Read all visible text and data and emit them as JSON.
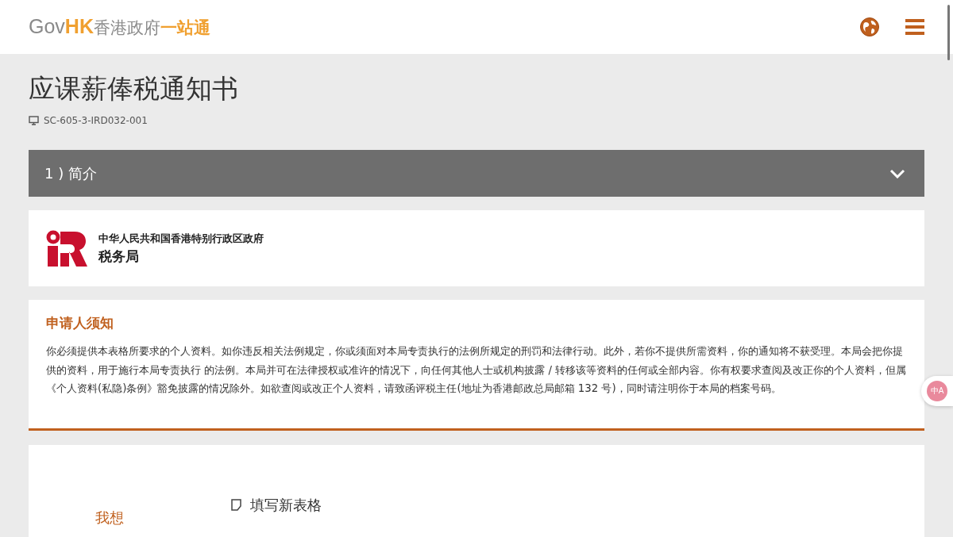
{
  "header": {
    "logo": {
      "gov": "Gov",
      "hk": "HK",
      "name": "香港政府",
      "tagline": "一站通"
    }
  },
  "page": {
    "title": "应课薪俸税通知书",
    "code": "SC-605-3-IRD032-001"
  },
  "sections": [
    {
      "label": "1 ) 简介",
      "expanded": false
    }
  ],
  "department": {
    "line_1": "中华人民共和国香港特别行政区政府",
    "line_2": "税务局"
  },
  "notice": {
    "heading": "申请人须知",
    "body": "你必须提供本表格所要求的个人资料。如你违反相关法例规定，你或须面对本局专责执行的法例所规定的刑罚和法律行动。此外，若你不提供所需资料，你的通知将不获受理。本局会把你提供的资料，用于施行本局专责执行 的法例。本局并可在法律授权或准许的情况下，向任何其他人士或机构披露 / 转移该等资料的任何或全部内容。你有权要求查阅及改正你的个人资料，但属《个人资料(私隐)条例》豁免披露的情况除外。如欲查阅或改正个人资料，请致函评税主任(地址为香港邮政总局邮箱 132 号)，同时请注明你于本局的档案号码。"
  },
  "options": {
    "label": "我想",
    "items": [
      {
        "label": "填写新表格"
      }
    ]
  },
  "translate_button": {
    "label": "中A"
  }
}
